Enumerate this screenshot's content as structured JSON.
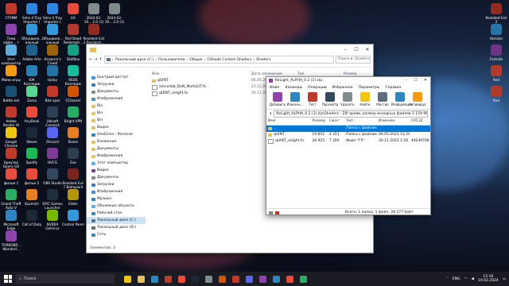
{
  "desktop": {
    "icons": [
      {
        "label": "СТРИМ",
        "color": "#c0392b"
      },
      {
        "label": "Sims 4 Tray Importer (",
        "color": "#2e86de"
      },
      {
        "label": "Sims 4 Tray Importer (",
        "color": "#2e86de"
      },
      {
        "label": "EA",
        "color": "#e74c3c"
      },
      {
        "label": "2024-02-19... 2.0 (1)",
        "color": "#7f8c8d"
      },
      {
        "label": "2024-02-19... 2.0 (1)",
        "color": "#7f8c8d"
      },
      {
        "label": "Тема эффе... т нормали",
        "color": "#8e44ad"
      },
      {
        "label": "Объедине... альный",
        "color": "#3498db"
      },
      {
        "label": "Объедине... альный",
        "color": "#3498db"
      },
      {
        "label": "Red Dead Redemptr...",
        "color": "#b03a2e"
      },
      {
        "label": "Resident Evil 2 Resident...",
        "color": "#922b21"
      },
      {
        "label": "Этот компьютер",
        "color": "#5dade2"
      },
      {
        "label": "Adobe Arte",
        "color": "#1f618d"
      },
      {
        "label": "Assassin's Creed Origins",
        "color": "#9c640c"
      },
      {
        "label": "SkillBox",
        "color": "#16a085"
      },
      {
        "label": "Мини игры",
        "color": "#f39c12"
      },
      {
        "label": "ЮК Колледж",
        "color": "#2980b9"
      },
      {
        "label": "Uplay",
        "color": "#2471a3"
      },
      {
        "label": "REDS Колледж",
        "color": "#1abc9c"
      },
      {
        "label": "Battle.net",
        "color": "#1b4f72"
      },
      {
        "label": "Zoma",
        "color": "#58d68d"
      },
      {
        "label": "Bite spar",
        "color": "#c0392b"
      },
      {
        "label": "CCleaner",
        "color": "#d35400"
      },
      {
        "label": "Adobe Reader XI",
        "color": "#c0392b"
      },
      {
        "label": "AnyDesk",
        "color": "#e74c3c"
      },
      {
        "label": "Ubisoft Connect",
        "color": "#2e4053"
      },
      {
        "label": "Bright VPN",
        "color": "#27ae60"
      },
      {
        "label": "Google Chrome",
        "color": "#f1c40f"
      },
      {
        "label": "Steam",
        "color": "#1b2838"
      },
      {
        "label": "Discord",
        "color": "#5865f2"
      },
      {
        "label": "Brave",
        "color": "#e67e22"
      },
      {
        "label": "Браузер Opera GX",
        "color": "#c0392b"
      },
      {
        "label": "Spotify",
        "color": "#1db954"
      },
      {
        "label": "HVCG",
        "color": "#7d3c98"
      },
      {
        "label": "Eve",
        "color": "#2c3e50"
      },
      {
        "label": "фильм 1",
        "color": "#e74c3c"
      },
      {
        "label": "фильм 2",
        "color": "#e74c3c"
      },
      {
        "label": "OBS Studio",
        "color": "#34495e"
      },
      {
        "label": "Resident Evil 7 Biohazard",
        "color": "#7b241c"
      },
      {
        "label": "Grand Theft Auto V",
        "color": "#27ae60"
      },
      {
        "label": "Kuzmich",
        "color": "#e67e22"
      },
      {
        "label": "EPIC Games Launcher",
        "color": "#212f3c"
      },
      {
        "label": "Elden",
        "color": "#b7950b"
      },
      {
        "label": "Microsoft Edge",
        "color": "#2e86c1"
      },
      {
        "label": "Call of Duty",
        "color": "#1c2833"
      },
      {
        "label": "NVIDIA GeForce Expe",
        "color": "#76b900"
      },
      {
        "label": "Control Panel",
        "color": "#3498db"
      },
      {
        "label": "TURBOBR... Wonderf...",
        "color": "#8e44ad"
      }
    ],
    "right_icons": [
      {
        "label": "Resident Evil 2",
        "color": "#922b21"
      },
      {
        "label": "Horizon",
        "color": "#2874a6"
      },
      {
        "label": "Fortnite",
        "color": "#6c3483"
      },
      {
        "label": "Red",
        "color": "#b03a2e"
      },
      {
        "label": "Red",
        "color": "#b03a2e"
      }
    ]
  },
  "explorer": {
    "path": [
      "Локальный диск (C:)",
      "Пользователи",
      "Общие",
      "GShade Custom Shaders",
      "Shaders"
    ],
    "search_placeholder": "Поиск в: Shaders",
    "columns": [
      "Имя",
      "Дата изменения",
      "Тип",
      "Размер"
    ],
    "files": [
      {
        "name": "qUINT",
        "date": "06.05.2022 15:58",
        "type": "Папка с файлами",
        "size": ""
      },
      {
        "name": "amcollab_DoN_MultiLUT.fx",
        "date": "23.12.2021 18:1",
        "type": "Файл \"FX\"",
        "size": ""
      },
      {
        "name": "qUINT_relight.fx",
        "date": "30.11.2022 1:56",
        "type": "Файл \"FX\"",
        "size": ""
      }
    ],
    "nav": [
      {
        "label": "Быстрый доступ",
        "color": "#3b8ed8"
      },
      {
        "label": "Загрузки",
        "color": "#2f7fc8"
      },
      {
        "label": "Документы",
        "color": "#7f8c8d"
      },
      {
        "label": "Изображения",
        "color": "#3b8ed8"
      },
      {
        "label": "Bin",
        "color": "#e8c15a"
      },
      {
        "label": "Bin",
        "color": "#e8c15a"
      },
      {
        "label": "Bin",
        "color": "#e8c15a"
      },
      {
        "label": "Видео",
        "color": "#e8c15a"
      },
      {
        "label": "OneDrive - Personal",
        "color": "#2e86c1"
      },
      {
        "label": "Вложения",
        "color": "#e8c15a"
      },
      {
        "label": "Документы",
        "color": "#e8c15a"
      },
      {
        "label": "Изображения",
        "color": "#e8c15a"
      },
      {
        "label": "Этот компьютер",
        "color": "#5dade2"
      },
      {
        "label": "Видео",
        "color": "#7d3c98"
      },
      {
        "label": "Документы",
        "color": "#7f8c8d"
      },
      {
        "label": "Загрузки",
        "color": "#2f7fc8"
      },
      {
        "label": "Изображения",
        "color": "#3b8ed8"
      },
      {
        "label": "Музыка",
        "color": "#2e86c1"
      },
      {
        "label": "Объемные объекты",
        "color": "#5dade2"
      },
      {
        "label": "Рабочий стол",
        "color": "#2e86c1"
      },
      {
        "label": "Локальный диск (C:)",
        "color": "#5d6d7e"
      },
      {
        "label": "Локальный диск (D:)",
        "color": "#5d6d7e"
      },
      {
        "label": "Сеть",
        "color": "#2e86c1"
      }
    ],
    "selected_nav": 20,
    "status": "Элементов: 3"
  },
  "winrar": {
    "title": "ReLight_ALPHA_0.2 (1).zip",
    "menu": [
      "Файл",
      "Команды",
      "Операции",
      "Избранное",
      "Параметры",
      "Справка"
    ],
    "tools": [
      {
        "label": "Добавить",
        "color": "#8e44ad"
      },
      {
        "label": "Извлечь...",
        "color": "#2e86c1"
      },
      {
        "label": "Тест",
        "color": "#c0392b"
      },
      {
        "label": "Просмотр",
        "color": "#34495e"
      },
      {
        "label": "Удалить",
        "color": "#7f8c8d"
      },
      {
        "label": "Найти",
        "color": "#f1c40f"
      },
      {
        "label": "Мастер",
        "color": "#5d6d7e"
      },
      {
        "label": "Информация",
        "color": "#2e86c1"
      },
      {
        "label": "Антивирус",
        "color": "#f39c12"
      }
    ],
    "pathbar": "ReLight_ALPHA_0.2 (1).zip\\Shaders - ZIP архив, размер исходных файлов 3 159 967 байт",
    "columns": [
      "Имя",
      "Размер",
      "Сжат",
      "Тип",
      "Изменён",
      "CRC32"
    ],
    "rows": [
      {
        "name": "..",
        "size": "",
        "packed": "",
        "type": "Папка с файлами",
        "modified": "",
        "crc": ""
      },
      {
        "name": "qUINT",
        "size": "19 852",
        "packed": "3 351",
        "type": "Папка с файлами",
        "modified": "06.05.2022 15:58",
        "crc": ""
      },
      {
        "name": "qUINT_relight.fx",
        "size": "28 925",
        "packed": "7 300",
        "type": "Файл \"FX\"",
        "modified": "30.11.2022 1:56",
        "crc": "40E49708"
      }
    ],
    "status": "Всего: 1 папка, 1 файл, 28 577 байт"
  },
  "taskbar": {
    "search_placeholder": "Поиск",
    "apps": [
      "#f1c40f",
      "#e8c15a",
      "#2e86c1",
      "#c0392b",
      "#e74c3c",
      "#1b2838",
      "#7f8c8d",
      "#d35400",
      "#c0392b",
      "#5865f2",
      "#8e44ad",
      "#2e86c1",
      "#e74c3c",
      "#27ae60"
    ],
    "lang": "ENG",
    "time": "15:16",
    "date": "19.02.2024"
  }
}
